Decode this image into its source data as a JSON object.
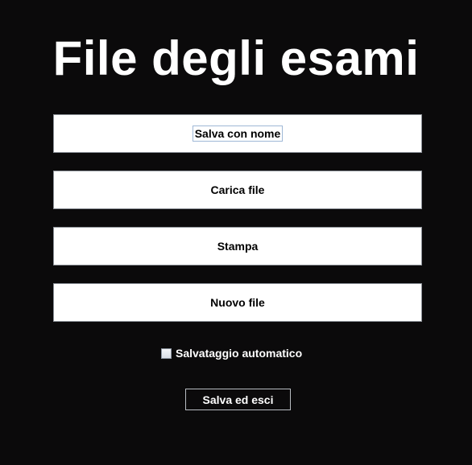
{
  "header": {
    "title": "File degli esami"
  },
  "menu": {
    "save_as_label": "Salva con nome",
    "load_label": "Carica file",
    "print_label": "Stampa",
    "new_label": "Nuovo file"
  },
  "options": {
    "autosave_label": "Salvataggio automatico",
    "autosave_checked": false
  },
  "footer": {
    "save_exit_label": "Salva ed esci"
  },
  "colors": {
    "background": "#0b0a0b",
    "button_background": "#ffffff",
    "text_light": "#ffffff",
    "text_dark": "#000000"
  }
}
